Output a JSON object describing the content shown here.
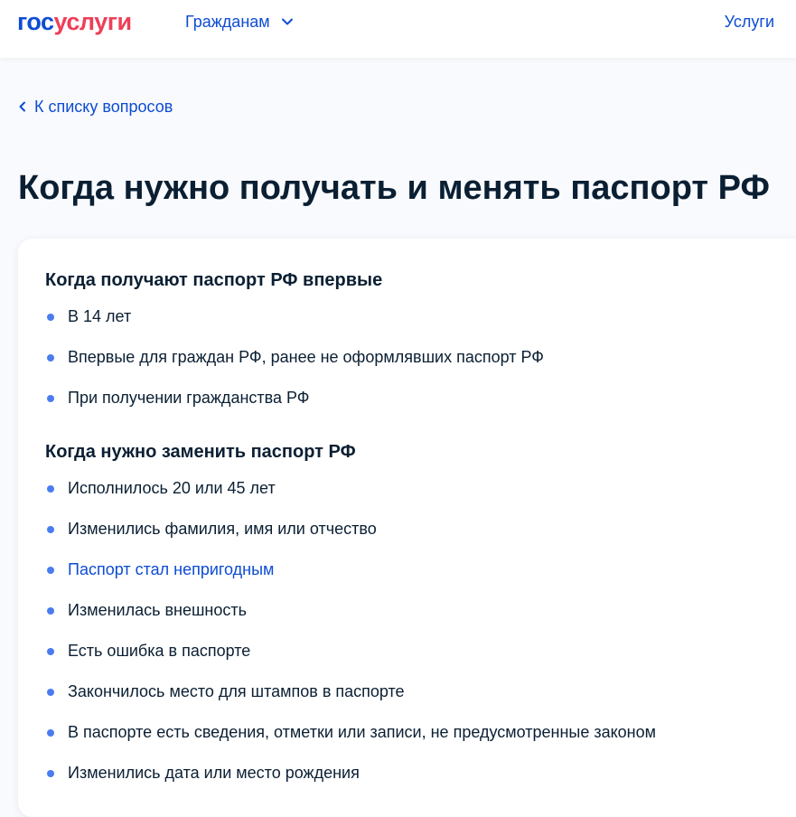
{
  "header": {
    "logo_part1": "гос",
    "logo_part2": "услуги",
    "nav_citizens": "Гражданам",
    "nav_services": "Услуги"
  },
  "back_link": "К списку вопросов",
  "page_title": "Когда нужно получать и менять паспорт РФ",
  "section_first": {
    "title": "Когда получают паспорт РФ впервые",
    "items": [
      "В 14 лет",
      "Впервые для граждан РФ, ранее не оформлявших паспорт РФ",
      "При получении гражданства РФ"
    ]
  },
  "section_replace": {
    "title": "Когда нужно заменить паспорт РФ",
    "items": [
      "Исполнилось 20 или 45 лет",
      "Изменились фамилия, имя или отчество",
      "Паспорт стал непригодным",
      "Изменилась внешность",
      "Есть ошибка в паспорте",
      "Закончилось место для штампов в паспорте",
      "В паспорте есть сведения, отметки или записи, не предусмотренные законом",
      "Изменились дата или место рождения"
    ]
  },
  "colors": {
    "brand_blue": "#0d4cd3",
    "brand_red": "#ee3f58",
    "bullet": "#4a7cf0",
    "text": "#0b1f33"
  }
}
